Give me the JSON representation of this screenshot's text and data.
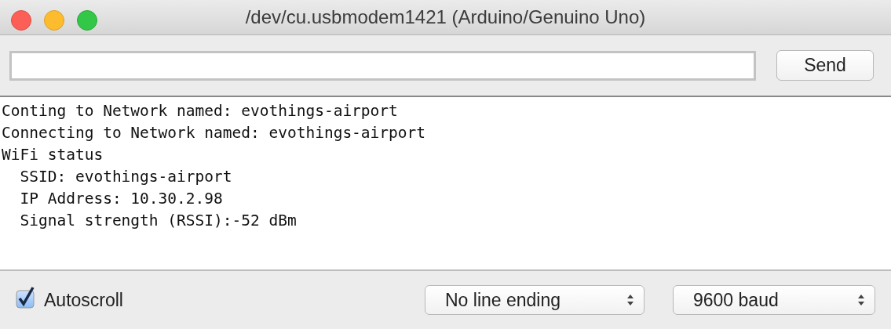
{
  "window": {
    "title": "/dev/cu.usbmodem1421 (Arduino/Genuino Uno)"
  },
  "send_button": "Send",
  "output_lines": [
    "Conting to Network named: evothings-airport",
    "Connecting to Network named: evothings-airport",
    "WiFi status",
    "  SSID: evothings-airport",
    "  IP Address: 10.30.2.98",
    "  Signal strength (RSSI):-52 dBm"
  ],
  "autoscroll": {
    "label": "Autoscroll",
    "checked": true
  },
  "line_ending": {
    "value": "No line ending"
  },
  "baud_rate": {
    "value": "9600 baud"
  }
}
